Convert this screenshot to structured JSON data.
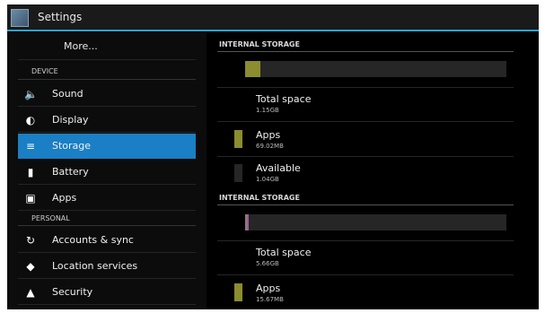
{
  "app": {
    "title": "Settings",
    "icon": "settings-app-icon"
  },
  "sidebar": {
    "more_label": "More...",
    "sections": [
      {
        "header": "DEVICE"
      },
      {
        "header": "PERSONAL"
      }
    ],
    "items": [
      {
        "label": "Sound",
        "icon": "sound-icon"
      },
      {
        "label": "Display",
        "icon": "display-icon"
      },
      {
        "label": "Storage",
        "icon": "storage-icon",
        "selected": true
      },
      {
        "label": "Battery",
        "icon": "battery-icon"
      },
      {
        "label": "Apps",
        "icon": "apps-icon"
      },
      {
        "label": "Accounts & sync",
        "icon": "sync-icon"
      },
      {
        "label": "Location services",
        "icon": "location-icon"
      },
      {
        "label": "Security",
        "icon": "lock-icon"
      }
    ],
    "selected_color": "#1a7fc4"
  },
  "storage": [
    {
      "header": "INTERNAL STORAGE",
      "total_label": "Total space",
      "total_value": "1.15GB",
      "usage_fraction": 0.06,
      "entries": [
        {
          "label": "Apps",
          "value": "69.02MB",
          "color": "#8c8c30"
        },
        {
          "label": "Available",
          "value": "1.04GB",
          "color": "#262626"
        }
      ]
    },
    {
      "header": "INTERNAL STORAGE",
      "total_label": "Total space",
      "total_value": "5.66GB",
      "usage_fraction": 0.012,
      "entries": [
        {
          "label": "Apps",
          "value": "15.67MB",
          "color": "#8c8c30"
        }
      ],
      "bar_segments": [
        {
          "color": "#8c8c30",
          "fraction": 0.006
        },
        {
          "color": "#a34fc0",
          "fraction": 0.006
        }
      ]
    }
  ]
}
